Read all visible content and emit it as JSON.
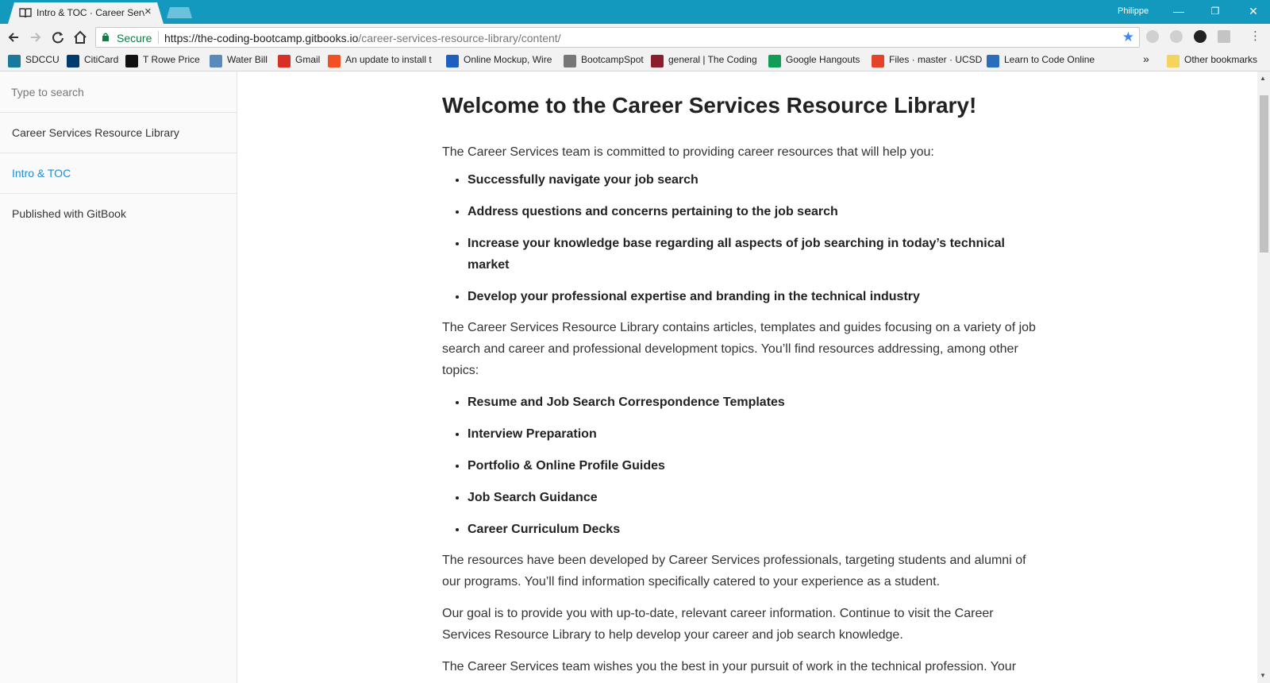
{
  "window": {
    "tab_title": "Intro & TOC · Career Services",
    "profile_name": "Philippe",
    "minimize": "—",
    "restore": "❐",
    "close": "✕"
  },
  "address_bar": {
    "secure_label": "Secure",
    "url_host": "https://the-coding-bootcamp.gitbooks.io",
    "url_path": "/career-services-resource-library/content/"
  },
  "bookmarks": {
    "items": [
      {
        "label": "SDCCU",
        "icon": "sdccu-icon",
        "color": "#1a7a9c"
      },
      {
        "label": "CitiCard",
        "icon": "citi-icon",
        "color": "#003b70"
      },
      {
        "label": "T Rowe Price",
        "icon": "trowe-icon",
        "color": "#111111"
      },
      {
        "label": "Water Bill",
        "icon": "water-icon",
        "color": "#5a8ab8"
      },
      {
        "label": "Gmail",
        "icon": "gmail-icon",
        "color": "#d93025"
      },
      {
        "label": "An update to install t",
        "icon": "windows-icon",
        "color": "#f25022"
      },
      {
        "label": "Online Mockup, Wire",
        "icon": "mockup-icon",
        "color": "#1f5fbf"
      },
      {
        "label": "BootcampSpot",
        "icon": "page-icon",
        "color": "#777777"
      },
      {
        "label": "general | The Coding",
        "icon": "slack-icon",
        "color": "#8b1e2b"
      },
      {
        "label": "Google Hangouts",
        "icon": "hangouts-icon",
        "color": "#0f9d58"
      },
      {
        "label": "Files · master · UCSD",
        "icon": "gitlab-icon",
        "color": "#e24329"
      },
      {
        "label": "Learn to Code Online",
        "icon": "code-icon",
        "color": "#2a6ebb"
      }
    ],
    "overflow": "»",
    "other_bookmarks": "Other bookmarks"
  },
  "sidebar": {
    "search_placeholder": "Type to search",
    "items": [
      {
        "label": "Career Services Resource Library"
      },
      {
        "label": "Intro & TOC"
      },
      {
        "label": "Published with GitBook"
      }
    ]
  },
  "article": {
    "title": "Welcome to the Career Services Resource Library!",
    "intro": "The Career Services team is committed to providing career resources that will help you:",
    "goals": [
      "Successfully navigate your job search",
      "Address questions and concerns pertaining to the job search",
      "Increase your knowledge base regarding all aspects of job searching in today’s technical market",
      "Develop your professional expertise and branding in the technical industry"
    ],
    "library_paragraph": "The Career Services Resource Library contains articles, templates and guides focusing on a variety of job search and career and professional development topics. You’ll find resources addressing, among other topics:",
    "topics": [
      "Resume and Job Search Correspondence Templates",
      "Interview Preparation",
      "Portfolio & Online Profile Guides",
      "Job Search Guidance",
      "Career Curriculum Decks"
    ],
    "developed_paragraph": "The resources have been developed by Career Services professionals, targeting students and alumni of our programs. You’ll find information specifically catered to your experience as a student.",
    "goal_paragraph": "Our goal is to provide you with up-to-date, relevant career information. Continue to visit the Career Services Resource Library to help develop your career and job search knowledge.",
    "closing_paragraph": "The Career Services team wishes you the best in your pursuit of work in the technical profession. Your"
  },
  "colors": {
    "titlebar": "#1399bd",
    "link_active": "#1f8dd6",
    "secure_green": "#0b8043"
  }
}
